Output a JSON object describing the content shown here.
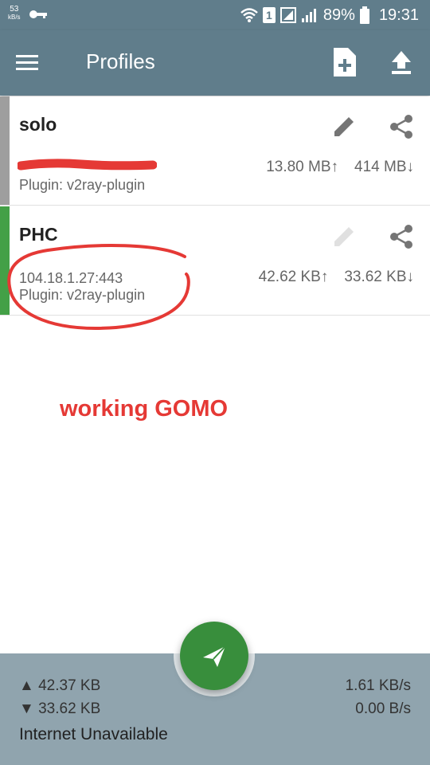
{
  "status_bar": {
    "net_speed_value": "53",
    "net_speed_unit": "kB/s",
    "sim_number": "1",
    "battery_percent": "89%",
    "time": "19:31"
  },
  "app_bar": {
    "title": "Profiles",
    "icons": [
      "menu-icon",
      "add-file-icon",
      "upload-icon"
    ]
  },
  "profiles": [
    {
      "name": "solo",
      "host_redacted": true,
      "plugin": "Plugin: v2ray-plugin",
      "upload": "13.80 MB",
      "download": "414 MB",
      "accent_color": "#9e9e9e"
    },
    {
      "name": "PHC",
      "host": "104.18.1.27:443",
      "plugin": "Plugin: v2ray-plugin",
      "upload": "42.62 KB",
      "download": "33.62 KB",
      "accent_color": "#43a047"
    }
  ],
  "annotation": {
    "text": "working GOMO",
    "color": "#e53935"
  },
  "bottom_bar": {
    "total_upload": "42.37 KB",
    "total_download": "33.62 KB",
    "upload_rate": "1.61 KB/s",
    "download_rate": "0.00 B/s",
    "status": "Internet Unavailable"
  },
  "colors": {
    "primary": "#607d8b",
    "bottom": "#90a4ae",
    "fab": "#388e3c"
  }
}
